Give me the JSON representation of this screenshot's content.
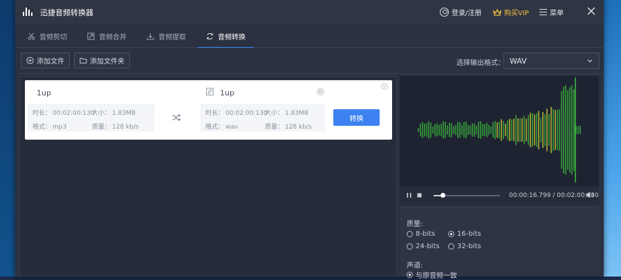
{
  "app": {
    "title": "迅捷音频转换器"
  },
  "titlebar": {
    "login_label": "登录/注册",
    "vip_label": "购买VIP",
    "menu_label": "菜单"
  },
  "tabs": [
    {
      "label": "音频剪切",
      "icon": "scissors-icon",
      "active": false
    },
    {
      "label": "音频合并",
      "icon": "merge-icon",
      "active": false
    },
    {
      "label": "音频提取",
      "icon": "extract-icon",
      "active": false
    },
    {
      "label": "音频转换",
      "icon": "convert-icon",
      "active": true
    }
  ],
  "toolbar": {
    "add_file": "添加文件",
    "add_folder": "添加文件夹",
    "format_label": "选择输出格式：",
    "format_value": "WAV"
  },
  "file_card": {
    "source": {
      "name": "1up",
      "duration_label": "时长：",
      "duration": "00:02:00:130",
      "size_label": "大小：",
      "size": "1.83MB",
      "format_label": "格式：",
      "format": "mp3",
      "quality_label": "质量：",
      "quality": "128 kb/s"
    },
    "output": {
      "name": "1up",
      "duration_label": "时长：",
      "duration": "00:02:00:130",
      "size_label": "大小：",
      "size": "1.83MB",
      "format_label": "格式：",
      "format": "wav",
      "quality_label": "质量：",
      "quality": "128 kb/s"
    },
    "convert_button": "转换"
  },
  "player": {
    "time": "00:00:16.799 / 00:02:00:130",
    "progress": 0.14
  },
  "settings": {
    "quality_label": "质量:",
    "quality_options": [
      {
        "label": "8-bits",
        "selected": false
      },
      {
        "label": "16-bits",
        "selected": true
      },
      {
        "label": "24-bits",
        "selected": false
      },
      {
        "label": "32-bits",
        "selected": false
      }
    ],
    "channel_label": "声道:",
    "channel_options": [
      {
        "label": "与原音频一致",
        "selected": true
      }
    ]
  },
  "colors": {
    "accent": "#3d82f0",
    "vip": "#f5c242",
    "wave_green": "#3fbf3f",
    "wave_yellow": "#d8d23a"
  }
}
